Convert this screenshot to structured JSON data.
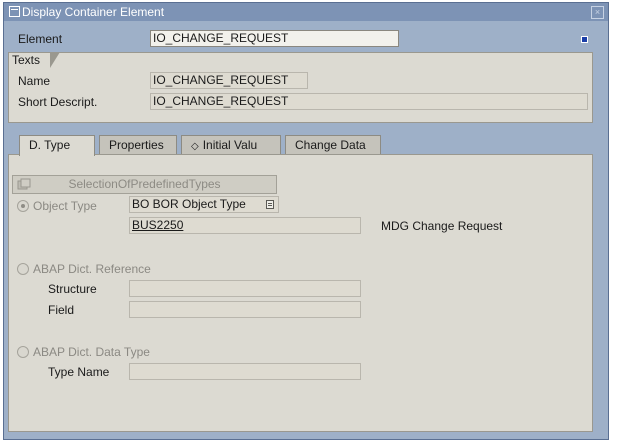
{
  "window": {
    "title": "Display Container Element",
    "title_icon": "window-icon",
    "close_icon": "close-icon",
    "close_glyph": "×"
  },
  "element": {
    "label": "Element",
    "value": "IO_CHANGE_REQUEST"
  },
  "texts": {
    "group_label": "Texts",
    "name_label": "Name",
    "name_value": "IO_CHANGE_REQUEST",
    "short_label": "Short Descript.",
    "short_value": "IO_CHANGE_REQUEST"
  },
  "tabs": [
    {
      "label": "D. Type"
    },
    {
      "label": "Properties"
    },
    {
      "label": "Initial Valu",
      "icon": "diamond-icon",
      "glyph": "◇"
    },
    {
      "label": "Change Data"
    }
  ],
  "dtype": {
    "selection_button": "SelectionOfPredefinedTypes",
    "object_type_label": "Object Type",
    "object_type_value": "BO BOR Object Type",
    "object_id": "BUS2250",
    "object_desc": "MDG Change Request",
    "abap_ref_label": "ABAP Dict. Reference",
    "structure_label": "Structure",
    "structure_value": "",
    "field_label": "Field",
    "field_value": "",
    "abap_data_label": "ABAP Dict. Data Type",
    "type_name_label": "Type Name",
    "type_name_value": ""
  },
  "colors": {
    "window_frame": "#9eb0c8",
    "titlebar": "#7d93b5",
    "panel": "#dcdad2",
    "field": "#dedbd1"
  }
}
